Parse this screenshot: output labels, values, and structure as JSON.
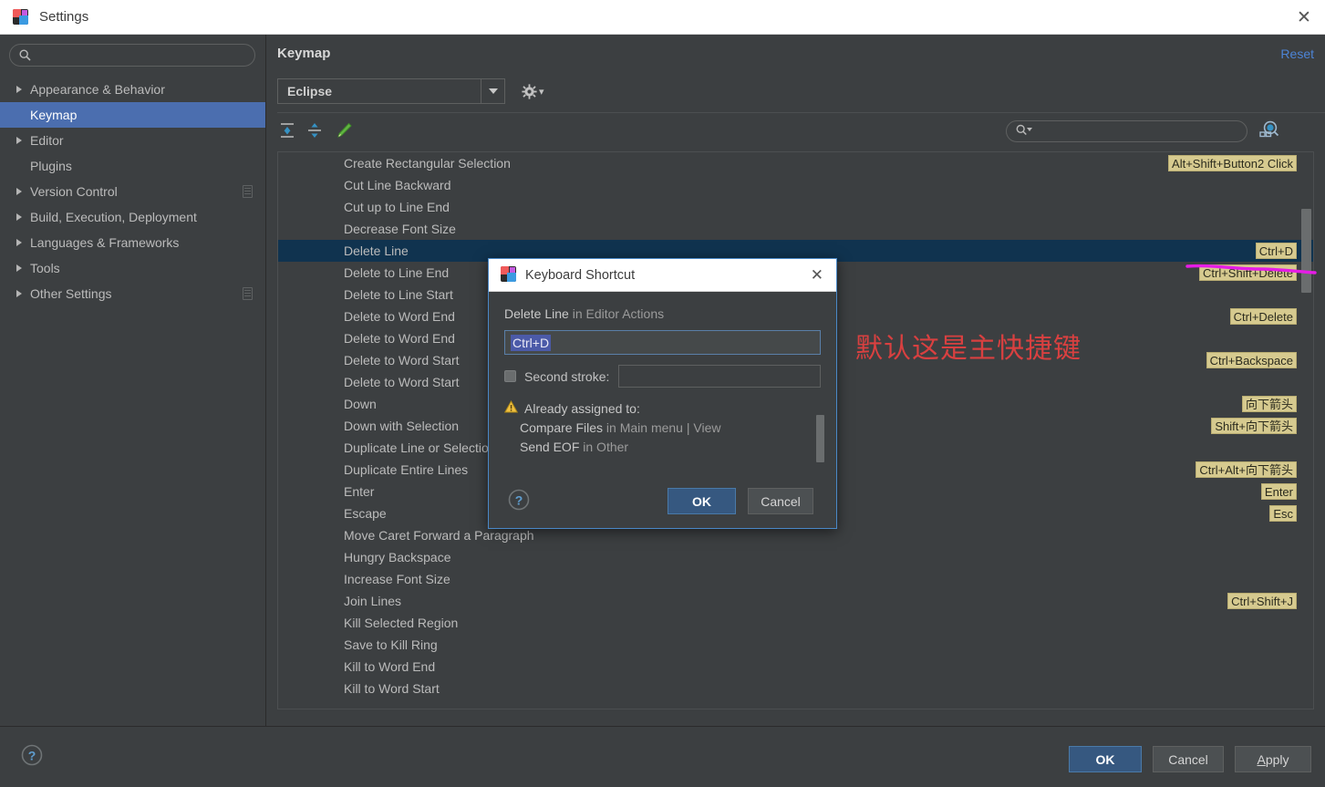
{
  "window": {
    "title": "Settings",
    "icon": "jetbrains-logo-icon",
    "close_label": "✕"
  },
  "sidebar": {
    "search": {
      "placeholder": "",
      "value": "",
      "icon": "search-icon"
    },
    "items": [
      {
        "label": "Appearance & Behavior",
        "expandable": true,
        "selected": false,
        "badge": false
      },
      {
        "label": "Keymap",
        "expandable": false,
        "selected": true,
        "badge": false
      },
      {
        "label": "Editor",
        "expandable": true,
        "selected": false,
        "badge": false
      },
      {
        "label": "Plugins",
        "expandable": false,
        "selected": false,
        "badge": false
      },
      {
        "label": "Version Control",
        "expandable": true,
        "selected": false,
        "badge": true
      },
      {
        "label": "Build, Execution, Deployment",
        "expandable": true,
        "selected": false,
        "badge": false
      },
      {
        "label": "Languages & Frameworks",
        "expandable": true,
        "selected": false,
        "badge": false
      },
      {
        "label": "Tools",
        "expandable": true,
        "selected": false,
        "badge": false
      },
      {
        "label": "Other Settings",
        "expandable": true,
        "selected": false,
        "badge": true
      }
    ]
  },
  "main": {
    "page_title": "Keymap",
    "reset_label": "Reset",
    "keymap_combo": {
      "value": "Eclipse",
      "arrow_icon": "chevron-down-icon"
    },
    "gear_icon": "gear-dropdown-icon",
    "toolbar": {
      "expand_all_icon": "expand-all-icon",
      "collapse_all_icon": "collapse-all-icon",
      "edit_icon": "pencil-edit-icon"
    },
    "find": {
      "placeholder": "",
      "value": "",
      "icon": "search-dropdown-icon"
    },
    "find_by_shortcut_icon": "find-by-shortcut-icon",
    "annotation_red": "默认这是主快捷键",
    "rows": [
      {
        "name": "Create Rectangular Selection",
        "shortcut": "Alt+Shift+Button2 Click",
        "selected": false
      },
      {
        "name": "Cut Line Backward",
        "shortcut": "",
        "selected": false
      },
      {
        "name": "Cut up to Line End",
        "shortcut": "",
        "selected": false
      },
      {
        "name": "Decrease Font Size",
        "shortcut": "",
        "selected": false
      },
      {
        "name": "Delete Line",
        "shortcut": "Ctrl+D",
        "selected": true
      },
      {
        "name": "Delete to Line End",
        "shortcut": "Ctrl+Shift+Delete",
        "selected": false
      },
      {
        "name": "Delete to Line Start",
        "shortcut": "",
        "selected": false
      },
      {
        "name": "Delete to Word End",
        "shortcut": "Ctrl+Delete",
        "selected": false
      },
      {
        "name": "Delete to Word End",
        "shortcut": "",
        "selected": false
      },
      {
        "name": "Delete to Word Start",
        "shortcut": "Ctrl+Backspace",
        "selected": false
      },
      {
        "name": "Delete to Word Start",
        "shortcut": "",
        "selected": false
      },
      {
        "name": "Down",
        "shortcut": "向下箭头",
        "selected": false
      },
      {
        "name": "Down with Selection",
        "shortcut": "Shift+向下箭头",
        "selected": false
      },
      {
        "name": "Duplicate Line or Selection",
        "shortcut": "",
        "selected": false
      },
      {
        "name": "Duplicate Entire Lines",
        "shortcut": "Ctrl+Alt+向下箭头",
        "selected": false
      },
      {
        "name": "Enter",
        "shortcut": "Enter",
        "selected": false
      },
      {
        "name": "Escape",
        "shortcut": "Esc",
        "selected": false
      },
      {
        "name": "Move Caret Forward a Paragraph",
        "shortcut": "",
        "selected": false
      },
      {
        "name": "Hungry Backspace",
        "shortcut": "",
        "selected": false
      },
      {
        "name": "Increase Font Size",
        "shortcut": "",
        "selected": false
      },
      {
        "name": "Join Lines",
        "shortcut": "Ctrl+Shift+J",
        "selected": false
      },
      {
        "name": "Kill Selected Region",
        "shortcut": "",
        "selected": false
      },
      {
        "name": "Save to Kill Ring",
        "shortcut": "",
        "selected": false
      },
      {
        "name": "Kill to Word End",
        "shortcut": "",
        "selected": false
      },
      {
        "name": "Kill to Word Start",
        "shortcut": "",
        "selected": false
      }
    ]
  },
  "dialog": {
    "title": "Keyboard Shortcut",
    "icon": "jetbrains-logo-icon",
    "close_label": "✕",
    "caption_action": "Delete Line",
    "caption_suffix": " in Editor Actions",
    "first_stroke_value": "Ctrl+D",
    "second_stroke_label": "Second stroke:",
    "second_stroke_value": "",
    "warning_icon": "warning-triangle-icon",
    "assigned_title": "Already assigned to:",
    "assigned_items": [
      {
        "action": "Compare Files",
        "context": " in Main menu | View"
      },
      {
        "action": "Send EOF",
        "context": " in Other"
      }
    ],
    "help_icon": "help-question-icon",
    "ok_label": "OK",
    "cancel_label": "Cancel"
  },
  "footer": {
    "help_icon": "help-question-icon",
    "ok_label": "OK",
    "cancel_label": "Cancel",
    "apply_label": "Apply",
    "apply_mnemonic": "A",
    "apply_rest": "pply"
  },
  "colors": {
    "accent_blue": "#4b6eaf",
    "selected_row": "#10334f",
    "shortcut_badge": "#d6ca8f",
    "link_blue": "#4d84d6",
    "annotation_red": "#d94040",
    "ink_magenta": "#e61ce6"
  }
}
